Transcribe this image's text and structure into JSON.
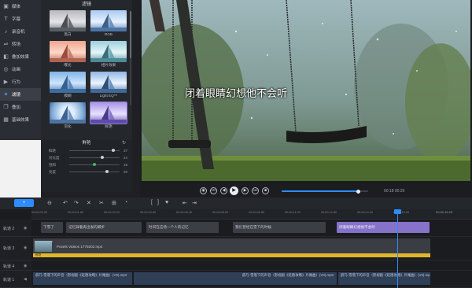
{
  "sidebar": {
    "items": [
      {
        "label": "媒体",
        "icon": "media-icon"
      },
      {
        "label": "字幕",
        "icon": "text-icon"
      },
      {
        "label": "录音机",
        "icon": "microphone-icon"
      },
      {
        "label": "转场",
        "icon": "transition-icon"
      },
      {
        "label": "叠加效果",
        "icon": "overlay-icon"
      },
      {
        "label": "动画",
        "icon": "animation-icon"
      },
      {
        "label": "行为",
        "icon": "behavior-icon"
      },
      {
        "label": "滤镜",
        "icon": "filter-icon"
      },
      {
        "label": "叠加",
        "icon": "stack-icon"
      },
      {
        "label": "基础效果",
        "icon": "basic-effects-icon"
      }
    ],
    "active_index": 7
  },
  "filters": {
    "title": "滤镜",
    "thumbnails": [
      {
        "label": "黑白"
      },
      {
        "label": "RGB"
      },
      {
        "label": "曝光"
      },
      {
        "label": "相片效果"
      },
      {
        "label": "模糊"
      },
      {
        "label": "Light EQ™"
      },
      {
        "label": "羽化"
      },
      {
        "label": "鲜艳"
      }
    ]
  },
  "adjust": {
    "title": "鲜艳",
    "sliders": [
      {
        "label": "鲜艳",
        "value": "37",
        "level": 0.84
      },
      {
        "label": "对比度",
        "value": "24",
        "level": 0.62
      },
      {
        "label": "饱和",
        "value": "18",
        "level": 0.48
      },
      {
        "label": "亮度",
        "value": "20",
        "level": 0.72
      }
    ]
  },
  "preview": {
    "subtitle": "闭着眼睛幻想他不会听",
    "timecode": "00:18  00:20",
    "progress": 0.88
  },
  "toolbar": {
    "add_label": "+"
  },
  "timeline": {
    "ruler_labels": [
      "00:00:00.00",
      "00:00:01.60",
      "00:00:03.20",
      "00:00:04.80",
      "00:00:06.40",
      "00:00:08.00",
      "00:00:09.60",
      "00:00:11.20",
      "00:00:12.80",
      "00:00:14.40",
      "00:00:16.00"
    ],
    "playhead_label": "00:00:16.28",
    "tracks": [
      {
        "name": "轨道 2"
      },
      {
        "name": "轨道 3"
      },
      {
        "name": "轨道 4"
      },
      {
        "name": "轨道 1"
      }
    ],
    "text_clips": [
      {
        "label": "下雪了"
      },
      {
        "label": "记忆踩着再出发的脚步"
      },
      {
        "label": "时间在这场一个人的记忆"
      },
      {
        "label": "我们曾经在雪下的时候"
      },
      {
        "label": "闭着眼睛幻想他不会听"
      }
    ],
    "video_clip": {
      "top_label": "下雪了",
      "label": "Pexels Videos 1779202.mp4",
      "bar_label": "鲜艳"
    },
    "audio_clips": [
      {
        "label": "薛乃-雪落下的声音（影视剧《延禧攻略》片尾曲）(V0).mp3"
      },
      {
        "label": "薛乃-雪落下的声音（影视剧《延禧攻略》片尾曲）(V0).mp3"
      },
      {
        "label": "薛乃-雪落下的声音（影视剧《延禧攻略》片尾曲）(V0).mp3"
      }
    ]
  }
}
